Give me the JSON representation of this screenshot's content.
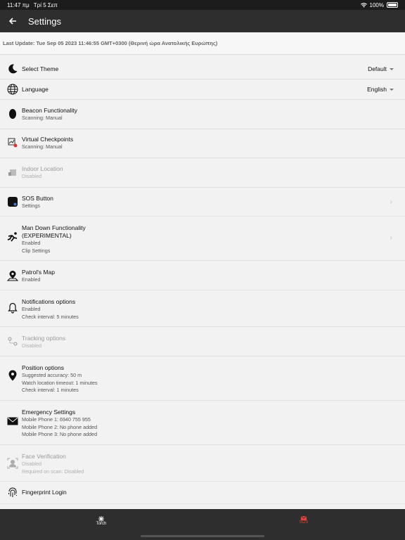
{
  "status_bar": {
    "time": "11:47 πμ",
    "date": "Τρί 5 Σεπ",
    "battery": "100%"
  },
  "header": {
    "title": "Settings"
  },
  "last_update": "Last Update: Tue Sep 05 2023 11:46:55 GMT+0300 (Θερινή ώρα Ανατολικής Ευρώπης)",
  "settings": {
    "theme": {
      "title": "Select Theme",
      "value": "Default"
    },
    "language": {
      "title": "Language",
      "value": "English"
    },
    "beacon": {
      "title": "Beacon Functionality",
      "sub": "Scanning: Manual"
    },
    "virtual": {
      "title": "Virtual Checkpoints",
      "sub": "Scanning: Manual"
    },
    "indoor": {
      "title": "Indoor Location",
      "sub": "Disabled"
    },
    "sos": {
      "title": "SOS Button",
      "sub": "Settings"
    },
    "mandown": {
      "title": "Man Down Functionality",
      "title2": "(EXPERIMENTAL)",
      "sub": "Enabled",
      "sub2": "Clip Settings"
    },
    "patrol": {
      "title": "Patrol's Map",
      "sub": "Enabled"
    },
    "notifications": {
      "title": "Notifications options",
      "sub": "Enabled",
      "sub2": "Check interval: 5 minutes"
    },
    "tracking": {
      "title": "Tracking options",
      "sub": "Disabled"
    },
    "position": {
      "title": "Position options",
      "sub": "Suggested accuracy: 50 m",
      "sub2": "Watch location timeout: 1 minutes",
      "sub3": "Check interval: 1 minutes"
    },
    "emergency": {
      "title": "Emergency Settings",
      "sub": "Mobile Phone 1: 6940 755 955",
      "sub2": "Mobile Phone 2: No phone added",
      "sub3": "Mobile Phone 3: No phone added"
    },
    "face": {
      "title": "Face Verification",
      "sub": "Disabled",
      "sub2": "Required on scan: Disabled"
    },
    "fingerprint": {
      "title": "Fingerprint Login"
    }
  },
  "bottom_nav": {
    "torch": "Torch",
    "sos": "SOS"
  },
  "colors": {
    "sos_accent": "#e0433a",
    "app_bar": "#2e2e2e"
  }
}
